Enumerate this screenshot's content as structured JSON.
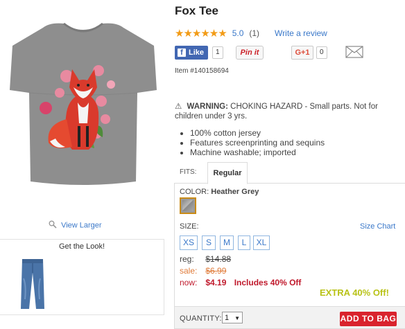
{
  "product": {
    "title": "Fox Tee",
    "stars": "★★★★★★",
    "rating": "5.0",
    "review_count": "(1)",
    "write_review": "Write a review",
    "item_number": "Item #140158694",
    "image_icon": "fox-tee-shirt"
  },
  "social": {
    "like_label": "Like",
    "like_count": "1",
    "pin_label": "Pin it",
    "gplus_label": "G+1",
    "gplus_count": "0",
    "mail_icon": "envelope-icon"
  },
  "warning": {
    "icon": "⚠",
    "label": "WARNING:",
    "text": "CHOKING HAZARD - Small parts. Not for children under 3 yrs."
  },
  "features": [
    "100% cotton jersey",
    "Features screenprinting and sequins",
    "Machine washable; imported"
  ],
  "left": {
    "view_larger": "View Larger",
    "look_title": "Get the Look!"
  },
  "fits": {
    "label": "FITS:",
    "selected_tab": "Regular"
  },
  "color": {
    "label": "COLOR:",
    "value": "Heather Grey",
    "swatch_color": "#9b9b9b"
  },
  "size": {
    "label": "SIZE:",
    "chart_link": "Size Chart",
    "options": [
      "XS",
      "S",
      "M",
      "L",
      "XL"
    ]
  },
  "pricing": {
    "reg_label": "reg:",
    "reg_value": "$14.88",
    "sale_label": "sale:",
    "sale_value": "$6.99",
    "now_label": "now:",
    "now_value": "$4.19",
    "includes": "Includes 40% Off",
    "extra": "EXTRA 40% Off!"
  },
  "purchase": {
    "quantity_label": "QUANTITY:",
    "quantity_value": "1",
    "add_to_bag": "ADD TO BAG"
  },
  "colors": {
    "accent_link": "#3a78c9",
    "star": "#f29b16",
    "sale": "#e07b39",
    "now": "#c0192c",
    "extra": "#b8c216",
    "add_button": "#d9232d",
    "facebook": "#4267b2"
  }
}
